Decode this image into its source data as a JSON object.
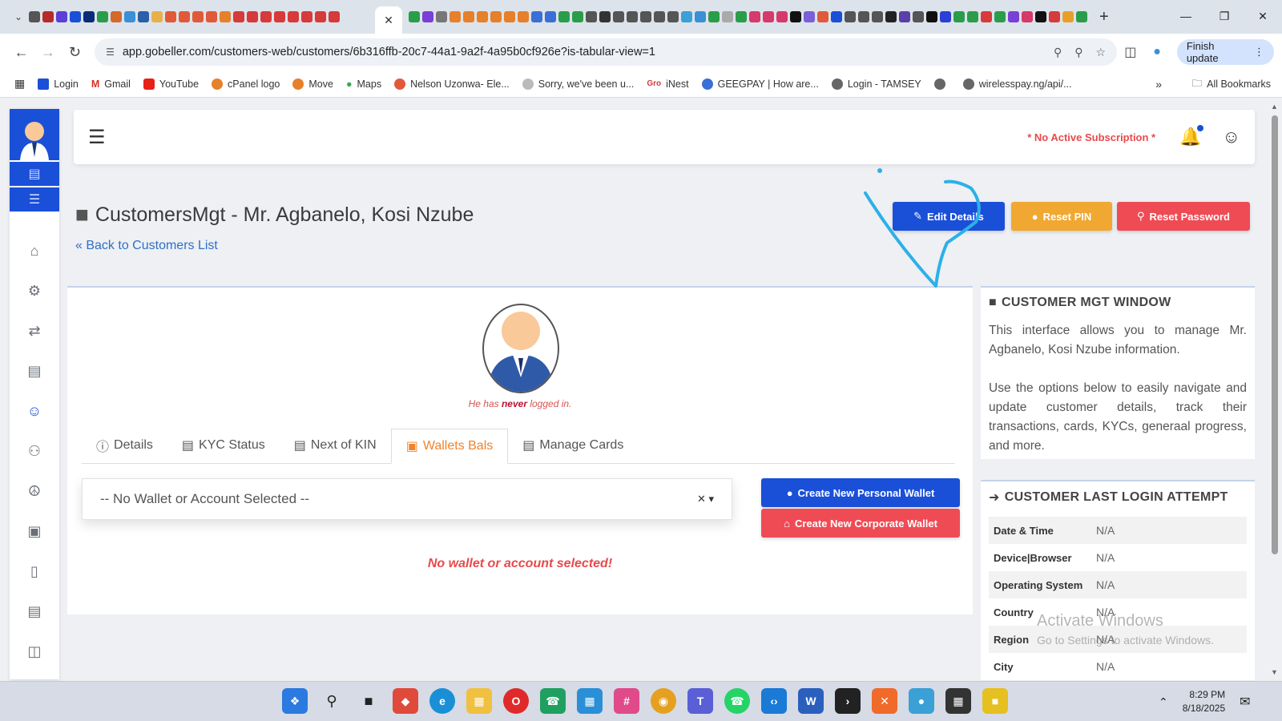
{
  "browser": {
    "url": "app.gobeller.com/customers-web/customers/6b316ffb-20c7-44a1-9a2f-4a95b0cf926e?is-tabular-view=1",
    "finish_update": "Finish update",
    "bookmarks": [
      "Login",
      "Gmail",
      "YouTube",
      "cPanel logo",
      "Move",
      "Maps",
      "Nelson Uzonwa- Ele...",
      "Sorry, we've been u...",
      "iNest",
      "GEEGPAY | How are...",
      "Login - TAMSEY",
      "",
      "wirelesspay.ng/api/..."
    ],
    "all_bookmarks": "All Bookmarks"
  },
  "header": {
    "subscription_warning": "* No Active Subscription *"
  },
  "page": {
    "title": "CustomersMgt - Mr. Agbanelo, Kosi Nzube",
    "back_link": "Back to Customers List",
    "edit_details": "Edit Details",
    "reset_pin": "Reset PIN",
    "reset_password": "Reset Password"
  },
  "profile": {
    "login_note_pre": "He has ",
    "login_note_bold": "never",
    "login_note_post": " logged in."
  },
  "tabs": [
    "Details",
    "KYC Status",
    "Next of KIN",
    "Wallets Bals",
    "Manage Cards"
  ],
  "wallet": {
    "select_placeholder": "-- No Wallet or Account Selected --",
    "create_personal": "Create New Personal Wallet",
    "create_corporate": "Create New Corporate Wallet",
    "empty_message": "No wallet or account selected!"
  },
  "info_panel": {
    "title": "CUSTOMER MGT WINDOW",
    "p1": "This interface allows you to manage Mr. Agbanelo, Kosi Nzube information.",
    "p2": "Use the options below to easily navigate and update customer details, track their transactions, cards, KYCs, generaal progress, and more."
  },
  "login_panel": {
    "title": "CUSTOMER LAST LOGIN ATTEMPT",
    "rows": [
      {
        "k": "Date & Time",
        "v": "N/A"
      },
      {
        "k": "Device|Browser",
        "v": "N/A"
      },
      {
        "k": "Operating System",
        "v": "N/A"
      },
      {
        "k": "Country",
        "v": "N/A"
      },
      {
        "k": "Region",
        "v": "N/A"
      },
      {
        "k": "City",
        "v": "N/A"
      }
    ]
  },
  "watermark": {
    "line1": "Activate Windows",
    "line2": "Go to Settings to activate Windows."
  },
  "taskbar": {
    "time": "8:29 PM",
    "date": "8/18/2025"
  },
  "colors": {
    "primary": "#1a4fd8",
    "warning": "#f0a832",
    "danger": "#ef4b55",
    "accent_tab": "#f0832c"
  }
}
